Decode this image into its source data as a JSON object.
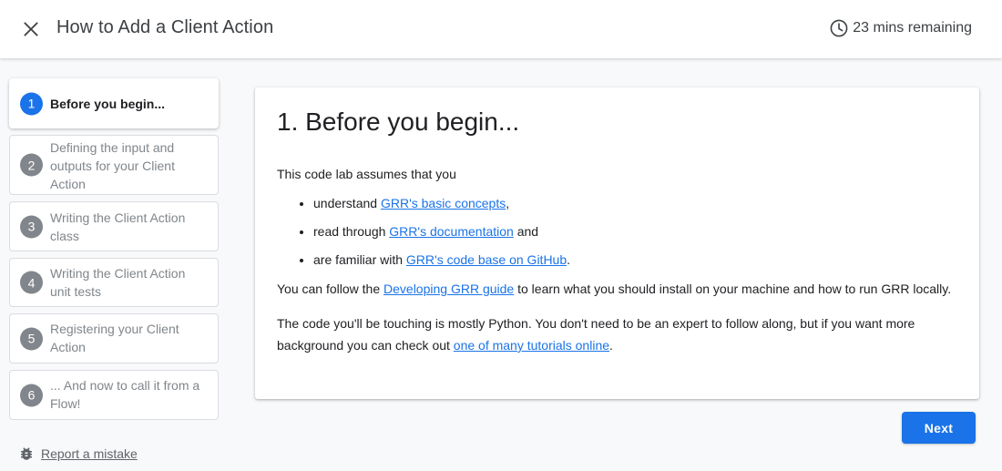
{
  "header": {
    "title": "How to Add a Client Action",
    "time_remaining": "23 mins remaining"
  },
  "sidebar": {
    "steps": [
      {
        "number": "1",
        "label": "Before you begin...",
        "active": true
      },
      {
        "number": "2",
        "label": "Defining the input and outputs for your Client Action",
        "active": false
      },
      {
        "number": "3",
        "label": "Writing the Client Action class",
        "active": false
      },
      {
        "number": "4",
        "label": "Writing the Client Action unit tests",
        "active": false
      },
      {
        "number": "5",
        "label": "Registering your Client Action",
        "active": false
      },
      {
        "number": "6",
        "label": "... And now to call it from a Flow!",
        "active": false
      }
    ],
    "report_label": "Report a mistake"
  },
  "content": {
    "heading": "1. Before you begin...",
    "intro": "This code lab assumes that you",
    "bullets": [
      {
        "before": "understand ",
        "link": "GRR's basic concepts",
        "after": ","
      },
      {
        "before": "read through ",
        "link": "GRR's documentation",
        "after": " and"
      },
      {
        "before": "are familiar with ",
        "link": "GRR's code base on GitHub",
        "after": "."
      }
    ],
    "para1": {
      "before": "You can follow the ",
      "link": "Developing GRR guide",
      "after": " to learn what you should install on your machine and how to run GRR locally."
    },
    "para2": {
      "before": "The code you'll be touching is mostly Python. You don't need to be an expert to follow along, but if you want more background you can check out ",
      "link": "one of many tutorials online",
      "after": "."
    }
  },
  "footer": {
    "next_label": "Next"
  },
  "icons": {
    "close": "close-icon",
    "timer": "clock-icon",
    "report": "bug-icon"
  },
  "colors": {
    "accent": "#1a73e8",
    "inactive_step": "#80868b",
    "background": "#f8f9fa"
  }
}
